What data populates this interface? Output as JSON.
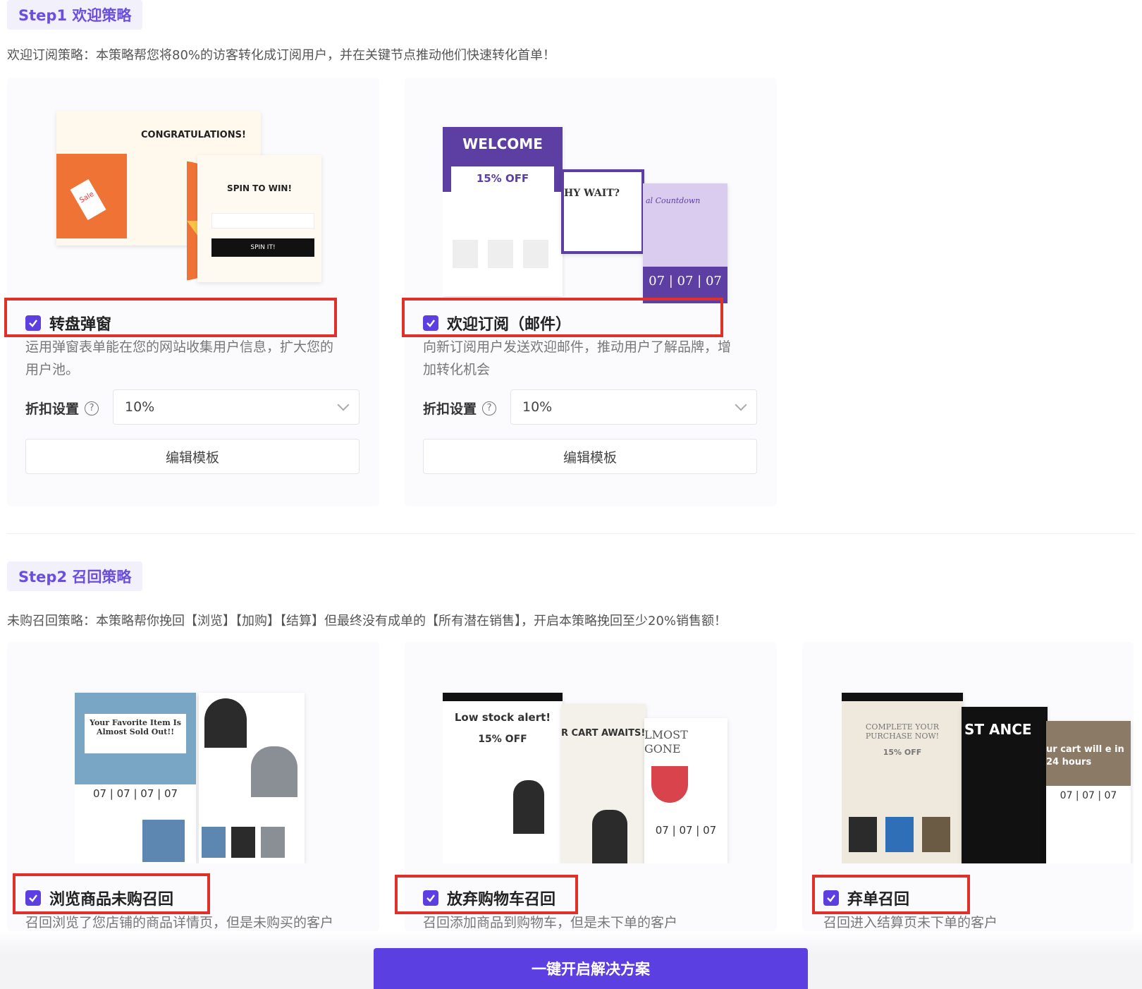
{
  "step1": {
    "tag": "Step1 欢迎策略",
    "desc": "欢迎订阅策略：本策略帮您将80%的访客转化成订阅用户，并在关键节点推动他们快速转化首单！",
    "cards": [
      {
        "title": "转盘弹窗",
        "desc_line1": "运用弹窗表单能在您的网站收集用户信息，扩大您的",
        "desc_line2": "用户池。",
        "discount_label": "折扣设置",
        "discount_value": "10%",
        "edit_label": "编辑模板",
        "preview": {
          "congrats": "CONGRATULATIONS!",
          "spin_title": "SPIN TO WIN!",
          "spin_btn": "SPIN IT!",
          "tag_text": "Sale"
        }
      },
      {
        "title": "欢迎订阅（邮件）",
        "desc_line1": "向新订阅用户发送欢迎邮件，推动用户了解品牌，增",
        "desc_line2": "加转化机会",
        "discount_label": "折扣设置",
        "discount_value": "10%",
        "edit_label": "编辑模板",
        "preview": {
          "welcome": "WELCOME",
          "off": "15% OFF",
          "why_wait": "HY WAIT?",
          "countdown": "al Countdown",
          "cd": "07 | 07 | 07"
        }
      }
    ]
  },
  "step2": {
    "tag": "Step2 召回策略",
    "desc": "未购召回策略：本策略帮你挽回【浏览】【加购】【结算】但最终没有成单的【所有潜在销售】，开启本策略挽回至少20%销售额！",
    "cards": [
      {
        "title": "浏览商品未购召回",
        "desc": "召回浏览了您店铺的商品详情页，但是未购买的客户",
        "preview": {
          "headline": "Your Favorite Item Is Almost Sold Out!!",
          "cd": "07 | 07 | 07 | 07"
        }
      },
      {
        "title": "放弃购物车召回",
        "desc": "召回添加商品到购物车，但是未下单的客户",
        "preview": {
          "headline": "Low stock alert!",
          "off": "15% OFF",
          "cart": "R CART AWAITS!",
          "almost": "LMOST GONE",
          "cd": "07 | 07 | 07"
        }
      },
      {
        "title": "弃单召回",
        "desc": "召回进入结算页未下单的客户",
        "preview": {
          "headline": "COMPLETE YOUR PURCHASE NOW!",
          "off": "15% OFF",
          "last": "ST ANCE",
          "cart_will": "ur cart will e in 24 hours",
          "cd": "07 | 07 | 07"
        }
      }
    ]
  },
  "primary_button": "一键开启解决方案",
  "colors": {
    "accent": "#5b3fe0",
    "highlight": "#e0302a",
    "tag_text": "#6a4ee0"
  }
}
